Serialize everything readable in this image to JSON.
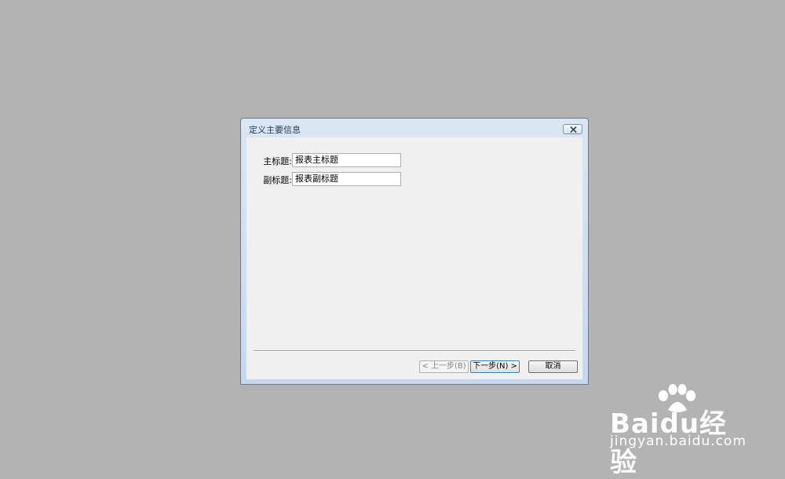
{
  "dialog": {
    "title": "定义主要信息",
    "fields": [
      {
        "label": "主标题:",
        "value": "报表主标题"
      },
      {
        "label": "副标题:",
        "value": "报表副标题"
      }
    ],
    "buttons": {
      "prev": "< 上一步(B)",
      "next": "下一步(N) >",
      "cancel": "取消"
    }
  },
  "watermark": {
    "brand": "Baidu经验",
    "url": "jingyan.baidu.com"
  },
  "colors": {
    "desktop": "#b3b3b3",
    "client": "#f0f0f0",
    "title_text": "#1e395b"
  }
}
